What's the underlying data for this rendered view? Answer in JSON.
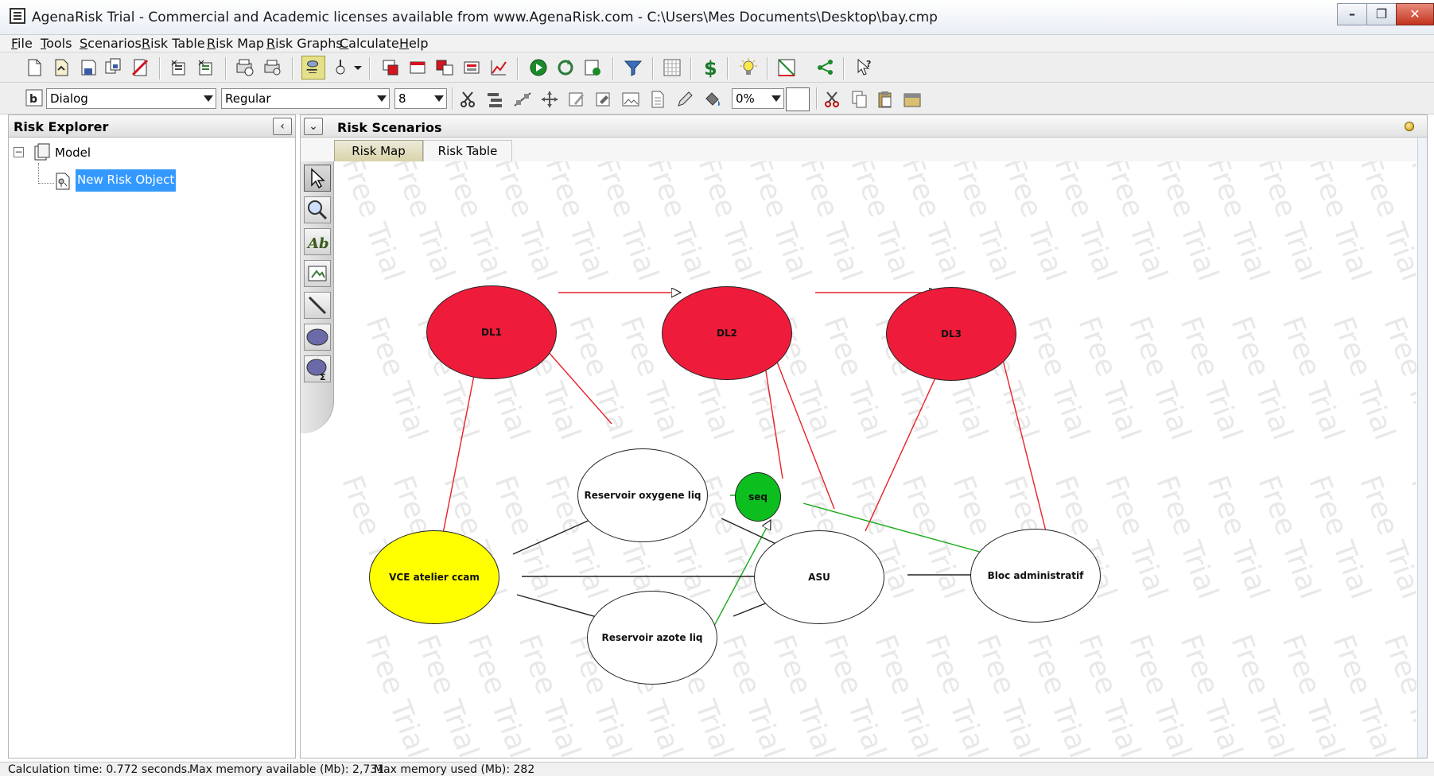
{
  "window": {
    "title": "AgenaRisk Trial - Commercial and Academic licenses available from www.AgenaRisk.com - C:\\Users\\Mes Documents\\Desktop\\bay.cmp"
  },
  "menu": [
    "File",
    "Tools",
    "Scenarios",
    "Risk Table",
    "Risk Map",
    "Risk Graphs",
    "Calculate",
    "Help"
  ],
  "format_bar": {
    "font": "Dialog",
    "style": "Regular",
    "size": "8",
    "transparency": "0%"
  },
  "explorer": {
    "title": "Risk Explorer",
    "collapse_glyph": "‹",
    "expander_glyph": "−",
    "model_label": "Model",
    "object_label": "New Risk Object"
  },
  "scenarios": {
    "toggle_glyph": "⌄",
    "title": "Risk Scenarios",
    "tabs": [
      "Risk Map",
      "Risk Table"
    ],
    "active_tab": "Risk Map"
  },
  "watermark": "Free Trial",
  "nodes": {
    "dl1": "DL1",
    "dl2": "DL2",
    "dl3": "DL3",
    "seq": "seq",
    "oxygen": "Reservoir oxygene liq",
    "vce": "VCE atelier ccam",
    "asu": "ASU",
    "bloc": "Bloc administratif",
    "azote": "Reservoir azote liq"
  },
  "colors": {
    "red_node": "#ee1c3a",
    "yellow_node": "#ffff00",
    "green_node": "#0cbf1e",
    "red_edge": "#e8202a",
    "green_edge": "#1aaa1a",
    "black_edge": "#222222",
    "selection": "#3399ff"
  },
  "status": {
    "calc_time": "Calculation time: 0.772 seconds.",
    "mem_available": "Max memory available (Mb): 2,731",
    "mem_used": "Max memory used (Mb): 282"
  }
}
